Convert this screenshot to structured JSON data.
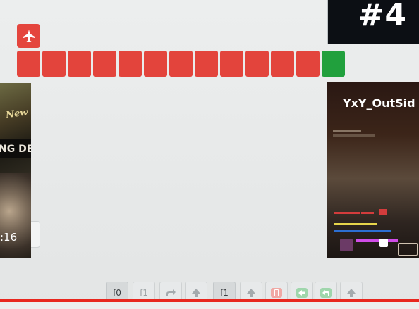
{
  "rank": {
    "label": "#4"
  },
  "character": {
    "icon": "fighter-jet-icon",
    "color": "#e4453d"
  },
  "rounds": [
    {
      "result": "loss"
    },
    {
      "result": "loss"
    },
    {
      "result": "loss"
    },
    {
      "result": "loss"
    },
    {
      "result": "loss"
    },
    {
      "result": "loss"
    },
    {
      "result": "loss"
    },
    {
      "result": "loss"
    },
    {
      "result": "loss"
    },
    {
      "result": "loss"
    },
    {
      "result": "loss"
    },
    {
      "result": "loss"
    },
    {
      "result": "win"
    }
  ],
  "left_thumbnail": {
    "top_title": "New Girl",
    "top_subtitle": "NG DEAD",
    "timestamp": ":16"
  },
  "stream": {
    "name": "YxY_OutSid"
  },
  "controls": {
    "group_a": [
      {
        "label": "f0",
        "style": "dark"
      },
      {
        "label": "f1",
        "style": "light"
      },
      {
        "label": "",
        "icon": "redo-arrow-icon",
        "style": "light"
      },
      {
        "label": "",
        "icon": "arrow-up-icon",
        "style": "light"
      }
    ],
    "group_b": [
      {
        "label": "f1",
        "style": "dark"
      },
      {
        "label": "",
        "icon": "arrow-up-icon",
        "style": "light"
      },
      {
        "label": "",
        "icon": "red-badge-icon",
        "style": "light"
      },
      {
        "label": "",
        "icon": "green-left-arrow-icon",
        "style": "light"
      },
      {
        "label": "",
        "icon": "green-return-arrow-icon",
        "style": "light"
      },
      {
        "label": "",
        "icon": "arrow-up-icon",
        "style": "light"
      }
    ]
  },
  "colors": {
    "loss": "#e3443c",
    "win": "#21a03d",
    "progress": "#e8271f"
  },
  "video_progress": 1.0
}
